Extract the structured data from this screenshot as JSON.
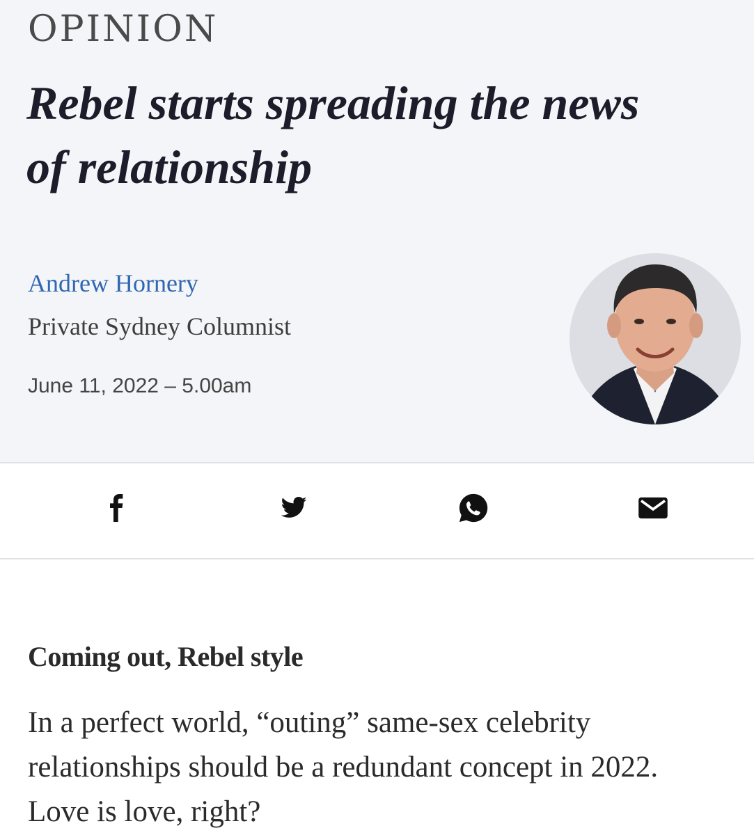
{
  "article": {
    "section": "OPINION",
    "headline": "Rebel starts spreading the news of relationship",
    "author_name": "Andrew Hornery",
    "author_role": "Private Sydney Columnist",
    "date": "June 11, 2022 – 5.00am",
    "subheading": "Coming out, Rebel style",
    "paragraph": "In a perfect world, “outing” same-sex celebrity relationships should be a redundant concept in 2022. Love is love, right?"
  },
  "share": {
    "icons": [
      "facebook-icon",
      "twitter-icon",
      "whatsapp-icon",
      "email-icon"
    ]
  },
  "colors": {
    "header_bg": "#f4f5f8",
    "author_link": "#2f67b3",
    "text": "#1b1b1b"
  }
}
